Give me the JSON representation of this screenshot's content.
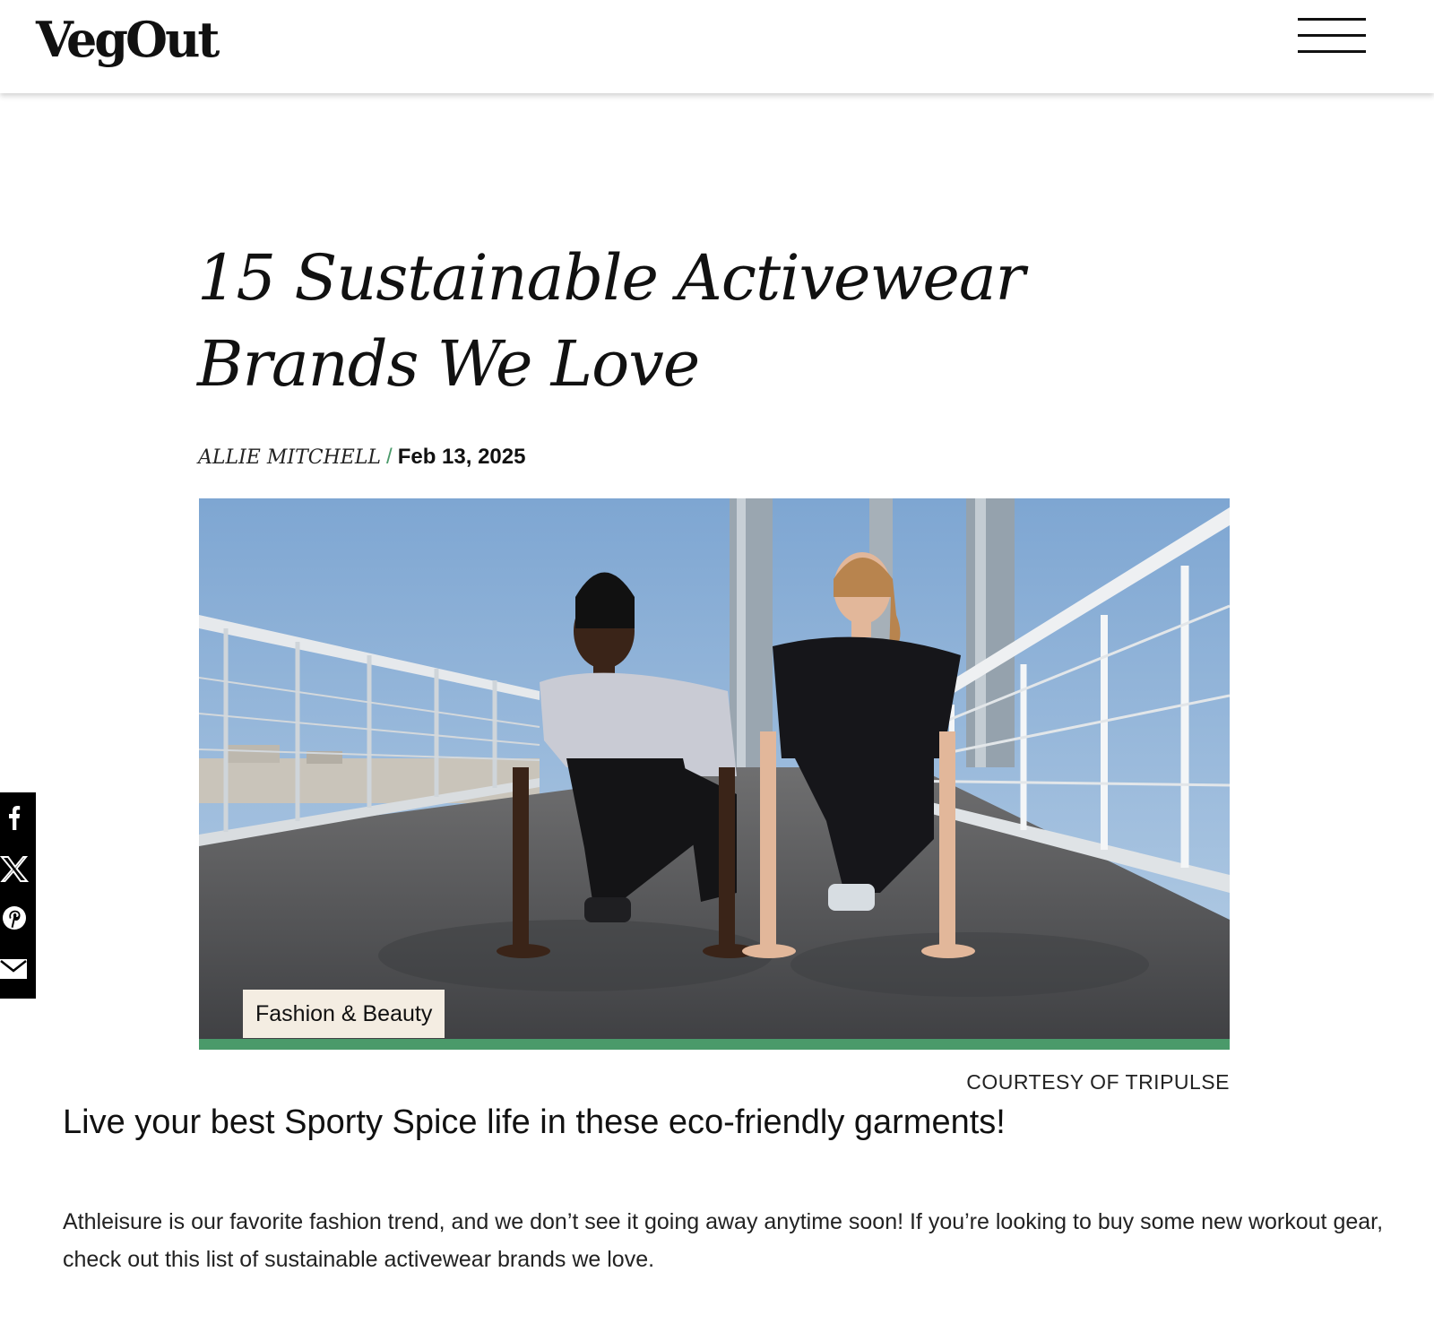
{
  "header": {
    "logo_text": "VegOut",
    "menu_icon": "hamburger-menu-icon"
  },
  "article": {
    "title": "15 Sustainable Activewear Brands We Love",
    "author": "ALLIE MITCHELL",
    "separator": "/",
    "date": "Feb 13, 2025",
    "category": "Fashion & Beauty",
    "image_credit": "COURTESY OF TRIPULSE",
    "subtitle": "Live your best Sporty Spice life in these eco-friendly garments!",
    "intro": "Athleisure is our favorite fashion trend, and we don’t see it going away anytime soon! If you’re looking to buy some new workout gear, check out this list of sustainable activewear brands we love."
  },
  "share": {
    "icons": [
      "facebook-icon",
      "x-icon",
      "pinterest-icon",
      "email-icon"
    ]
  },
  "colors": {
    "accent_green": "#4a9a6a",
    "tag_background": "#f4ede2",
    "share_bar": "#000000"
  }
}
